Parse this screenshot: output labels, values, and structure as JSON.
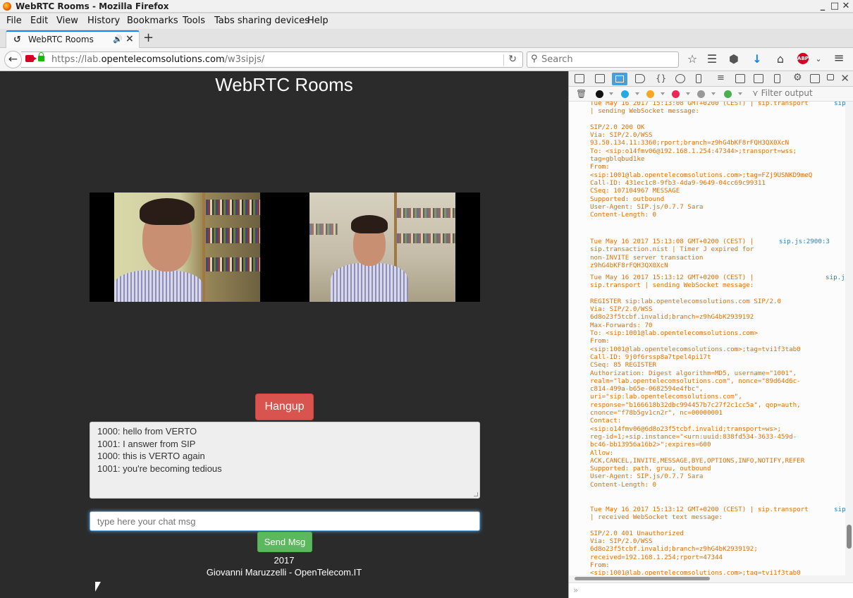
{
  "window": {
    "title": "WebRTC Rooms - Mozilla Firefox",
    "btn_min": "_",
    "btn_max": "□",
    "btn_close": "✕"
  },
  "menu": {
    "file": "File",
    "edit": "Edit",
    "view": "View",
    "history": "History",
    "bookmarks": "Bookmarks",
    "tools": "Tools",
    "tabs_sharing": "Tabs sharing devices",
    "help": "Help"
  },
  "tab": {
    "label": "WebRTC Rooms",
    "new_tab": "+"
  },
  "nav": {
    "url_prefix": "https://lab.",
    "url_domain": "opentelecomsolutions.com",
    "url_path": "/w3sipjs/",
    "search_placeholder": "Search"
  },
  "page": {
    "heading": "WebRTC Rooms",
    "hangup_label": "Hangup",
    "chat_messages": [
      "1000: hello from VERTO",
      "1001: I answer from SIP",
      "1000: this is VERTO again",
      "1001: you're becoming tedious"
    ],
    "chat_placeholder": "type here your chat msg",
    "send_label": "Send Msg",
    "footer_year": "2017",
    "footer_author": "Giovanni Maruzzelli - OpenTelecom.IT"
  },
  "devtools": {
    "filter_placeholder": "Filter output",
    "input_prompt": "»",
    "log": [
      {
        "text": "Tue May 16 2017 15:13:08 GMT+0200 (CEST) | sip.transport\n| sending WebSocket message:\n\nSIP/2.0 200 OK\nVia: SIP/2.0/WSS\n93.50.134.11:3360;rport;branch=z9hG4bKF8rFQH3QX0XcN\nTo: <sip:o14fmv06@192.168.1.254:47344>;transport=wss;\ntag=gblqbud1ke\nFrom:\n<sip:1001@lab.opentelecomsolutions.com>;tag=FZj9USNKD9meQ\nCall-ID: 431ec1c8-9fb3-4da9-9649-04cc69c99311\nCSeq: 107104967 MESSAGE\nSupported: outbound\nUser-Agent: SIP.js/0.7.7 Sara\nContent-Length: 0",
        "source": "sip"
      },
      {
        "text": "Tue May 16 2017 15:13:08 GMT+0200 (CEST) |\nsip.transaction.nist | Timer J expired for\nnon-INVITE server transaction\nz9hG4bKF8rFQH3QX0XcN",
        "source": "sip.js:2900:3"
      },
      {
        "text": "Tue May 16 2017 15:13:12 GMT+0200 (CEST) |\nsip.transport | sending WebSocket message:\n\nREGISTER sip:lab.opentelecomsolutions.com SIP/2.0\nVia: SIP/2.0/WSS\n6d8o23f5tcbf.invalid;branch=z9hG4bK2939192\nMax-Forwards: 70\nTo: <sip:1001@lab.opentelecomsolutions.com>\nFrom:\n<sip:1001@lab.opentelecomsolutions.com>;tag=tvi1f3tab0\nCall-ID: 9j0f6rssp8a7tpel4pi17t\nCSeq: 85 REGISTER\nAuthorization: Digest algorithm=MD5, username=\"1001\",\nrealm=\"lab.opentelecomsolutions.com\", nonce=\"89d64d6c-\nc814-499a-b65e-0682594e4fbc\",\nuri=\"sip:lab.opentelecomsolutions.com\",\nresponse=\"b166618b32dbc994457b7c27f2c1cc5a\", qop=auth,\ncnonce=\"f78b5gv1cn2r\", nc=00000001\nContact:\n<sip:o14fmv06@6d8o23f5tcbf.invalid;transport=ws>;\nreg-id=1;+sip.instance=\"<urn:uuid:838fd534-3633-459d-\nbc46-bb13956a16b2>\";expires=600\nAllow:\nACK,CANCEL,INVITE,MESSAGE,BYE,OPTIONS,INFO,NOTIFY,REFER\nSupported: path, gruu, outbound\nUser-Agent: SIP.js/0.7.7 Sara\nContent-Length: 0",
        "source": "sip.j"
      },
      {
        "text": "Tue May 16 2017 15:13:12 GMT+0200 (CEST) | sip.transport\n| received WebSocket text message:\n\nSIP/2.0 401 Unauthorized\nVia: SIP/2.0/WSS\n6d8o23f5tcbf.invalid;branch=z9hG4bK2939192;\nreceived=192.168.1.254;rport=47344\nFrom:\n<sip:1001@lab.opentelecomsolutions.com>;tag=tvi1f3tab0",
        "source": "sip"
      }
    ]
  },
  "colors": {
    "accent_tab": "#0a84ff",
    "hangup": "#d9534f",
    "send": "#5cb85c",
    "console_text": "#e26f00",
    "console_source": "#2a7fc4"
  }
}
